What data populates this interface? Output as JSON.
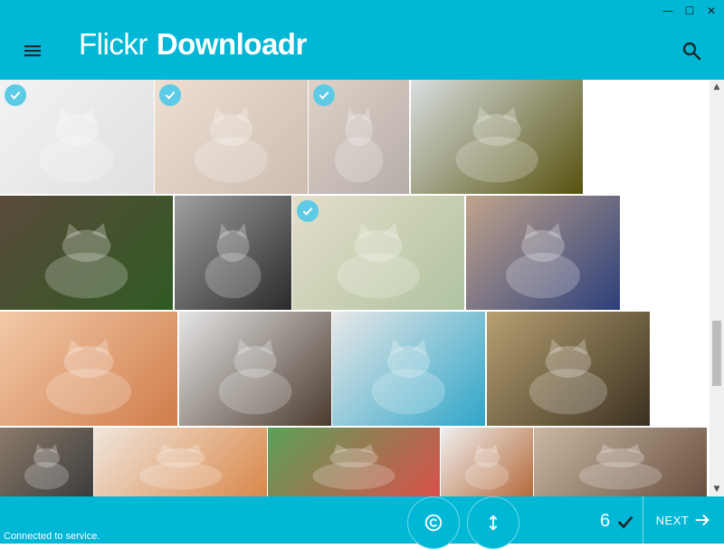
{
  "window": {
    "controls": [
      {
        "name": "minimize-icon",
        "glyph": "—"
      },
      {
        "name": "maximize-icon",
        "glyph": "☐"
      },
      {
        "name": "close-icon",
        "glyph": "✕"
      }
    ]
  },
  "header": {
    "brand_light": "Flickr",
    "brand_bold": "Downloadr",
    "menu_icon": "hamburger-menu-icon",
    "search_icon": "search-icon"
  },
  "colors": {
    "accent": "#00b7d6",
    "check": "#5dcbe6",
    "text_on_accent": "#ffffff"
  },
  "photos": [
    {
      "selected": true,
      "c1": "#e4e4e4",
      "c2": "#b9b9b9"
    },
    {
      "selected": true,
      "c1": "#d8b89a",
      "c2": "#8f6c52"
    },
    {
      "selected": true,
      "c1": "#b89a84",
      "c2": "#5e4a40"
    },
    {
      "selected": false,
      "c1": "#d9dfe0",
      "c2": "#57520f"
    },
    {
      "selected": false,
      "c1": "#5a4a3a",
      "c2": "#2f5a23"
    },
    {
      "selected": false,
      "c1": "#a0a0a0",
      "c2": "#2a2a2a"
    },
    {
      "selected": true,
      "c1": "#c6b68a",
      "c2": "#4f7a2a"
    },
    {
      "selected": false,
      "c1": "#c1a48c",
      "c2": "#2c3f7a"
    },
    {
      "selected": false,
      "c1": "#f2c9a8",
      "c2": "#d07d4a"
    },
    {
      "selected": false,
      "c1": "#e6e6e6",
      "c2": "#4a3a2e"
    },
    {
      "selected": false,
      "c1": "#e8e8e8",
      "c2": "#2fa6c8"
    },
    {
      "selected": false,
      "c1": "#b7a072",
      "c2": "#3b3120"
    },
    {
      "selected": false,
      "c1": "#8a7a6a",
      "c2": "#3c3c3c"
    },
    {
      "selected": false,
      "c1": "#f0e6dc",
      "c2": "#d9884a"
    },
    {
      "selected": false,
      "c1": "#5aa15a",
      "c2": "#d9504a"
    },
    {
      "selected": false,
      "c1": "#f0f0f0",
      "c2": "#b46a3a"
    },
    {
      "selected": false,
      "c1": "#c9b8a4",
      "c2": "#6a5040"
    }
  ],
  "footer": {
    "status": "Connected to service.",
    "license_icon": "copyright-icon",
    "sort_icon": "vertical-arrows-icon",
    "selected_count": "6",
    "selected_icon": "checkmark-icon",
    "next_label": "NEXT",
    "next_icon": "arrow-right-icon"
  },
  "scrollbar": {
    "up_icon": "scroll-up-arrow-icon",
    "down_icon": "scroll-down-arrow-icon"
  }
}
